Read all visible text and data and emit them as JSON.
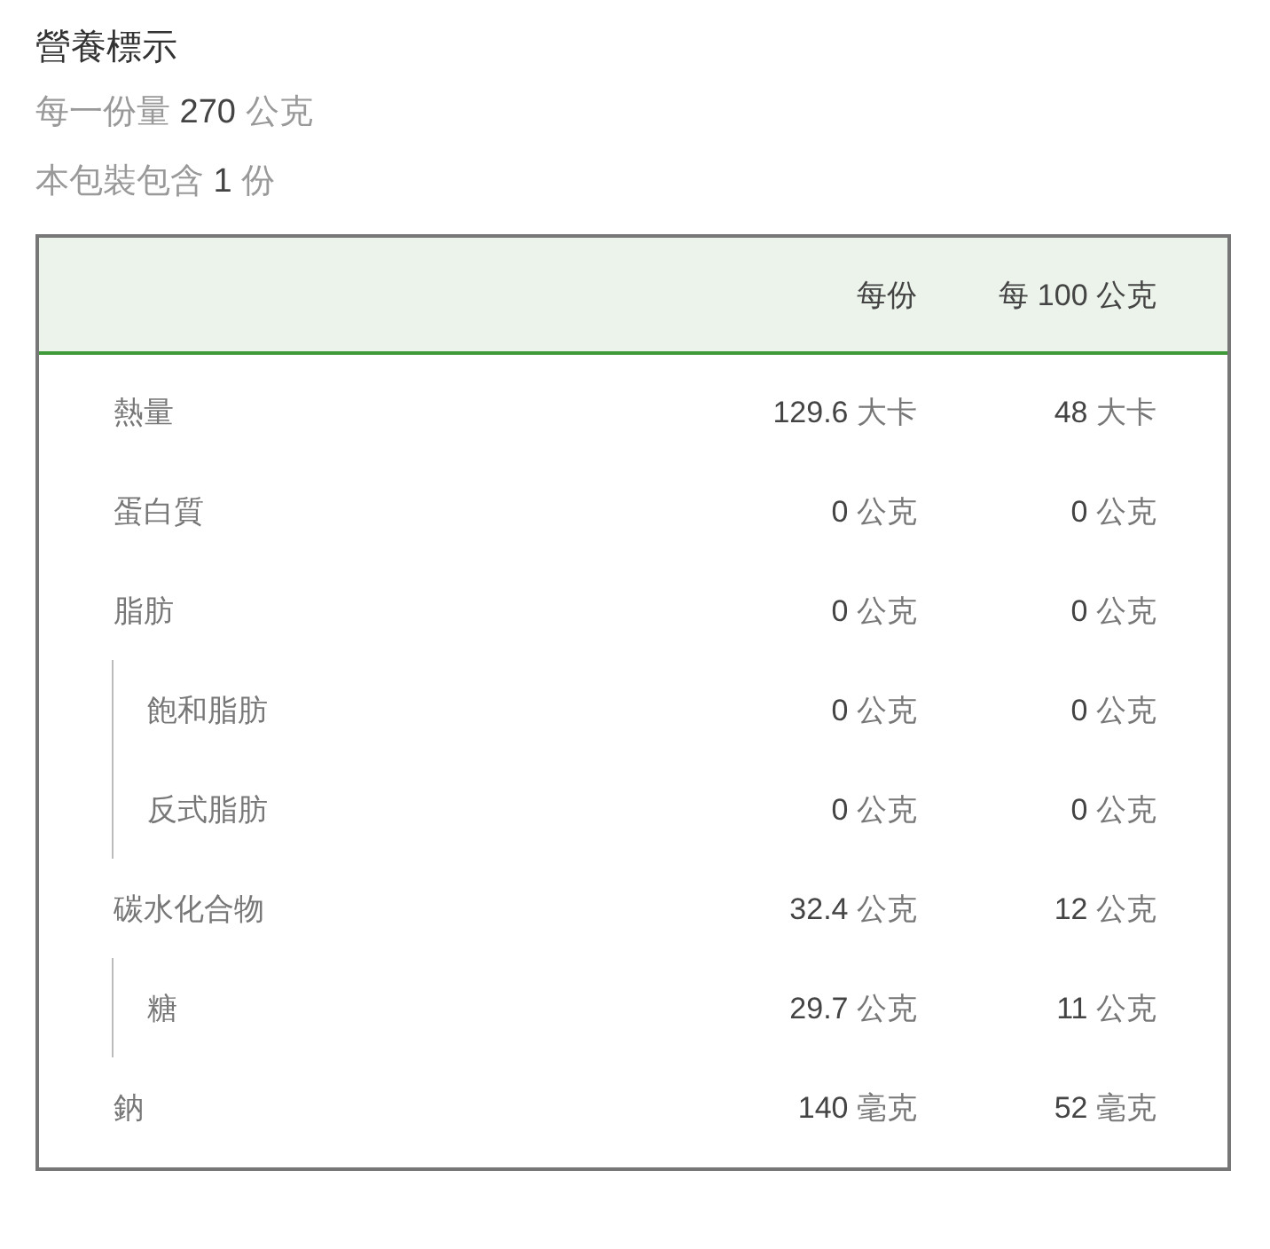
{
  "title": "營養標示",
  "serving_size": {
    "label": "每一份量",
    "amount": "270",
    "unit": "公克"
  },
  "servings_per_package": {
    "label": "本包裝包含",
    "amount": "1",
    "unit": "份"
  },
  "table": {
    "columns": [
      "每份",
      "每 100 公克"
    ],
    "rows": [
      {
        "name": "熱量",
        "per_serving": {
          "amount": "129.6",
          "unit": "大卡"
        },
        "per_100g": {
          "amount": "48",
          "unit": "大卡"
        }
      },
      {
        "name": "蛋白質",
        "per_serving": {
          "amount": "0",
          "unit": "公克"
        },
        "per_100g": {
          "amount": "0",
          "unit": "公克"
        }
      },
      {
        "name": "脂肪",
        "per_serving": {
          "amount": "0",
          "unit": "公克"
        },
        "per_100g": {
          "amount": "0",
          "unit": "公克"
        },
        "children": [
          {
            "name": "飽和脂肪",
            "per_serving": {
              "amount": "0",
              "unit": "公克"
            },
            "per_100g": {
              "amount": "0",
              "unit": "公克"
            }
          },
          {
            "name": "反式脂肪",
            "per_serving": {
              "amount": "0",
              "unit": "公克"
            },
            "per_100g": {
              "amount": "0",
              "unit": "公克"
            }
          }
        ]
      },
      {
        "name": "碳水化合物",
        "per_serving": {
          "amount": "32.4",
          "unit": "公克"
        },
        "per_100g": {
          "amount": "12",
          "unit": "公克"
        },
        "children": [
          {
            "name": "糖",
            "per_serving": {
              "amount": "29.7",
              "unit": "公克"
            },
            "per_100g": {
              "amount": "11",
              "unit": "公克"
            }
          }
        ]
      },
      {
        "name": "鈉",
        "per_serving": {
          "amount": "140",
          "unit": "毫克"
        },
        "per_100g": {
          "amount": "52",
          "unit": "毫克"
        }
      }
    ]
  }
}
